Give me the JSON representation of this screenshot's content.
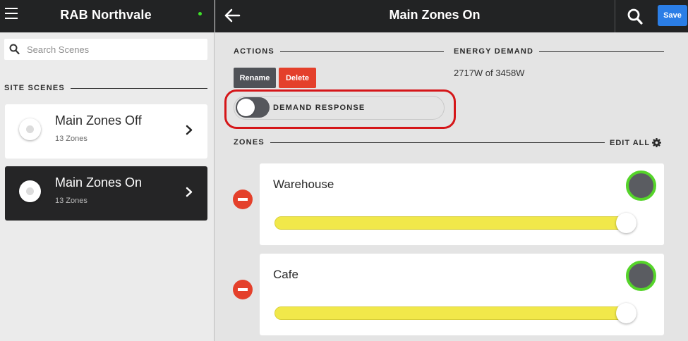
{
  "sidebar": {
    "title": "RAB Northvale",
    "status_color": "#3fe02a",
    "search_placeholder": "Search Scenes",
    "section_label": "SITE SCENES",
    "scenes": [
      {
        "name": "Main Zones Off",
        "subtitle": "13 Zones",
        "selected": false
      },
      {
        "name": "Main Zones On",
        "subtitle": "13 Zones",
        "selected": true
      }
    ]
  },
  "header": {
    "title": "Main Zones On",
    "save_label": "Save"
  },
  "actions": {
    "section_label": "ACTIONS",
    "rename_label": "Rename",
    "delete_label": "Delete"
  },
  "energy": {
    "section_label": "ENERGY DEMAND",
    "value": "2717W of 3458W"
  },
  "demand_response": {
    "label": "DEMAND RESPONSE",
    "enabled": false
  },
  "zones_section": {
    "label": "ZONES",
    "edit_all_label": "EDIT ALL"
  },
  "zones": [
    {
      "name": "Warehouse",
      "level": 1.0,
      "status_color": "#55d42a"
    },
    {
      "name": "Cafe",
      "level": 1.0,
      "status_color": "#55d42a"
    }
  ],
  "colors": {
    "accent": "#2b7ee6",
    "danger": "#e4402b",
    "slider": "#f1e84a",
    "highlight": "#d51619"
  }
}
